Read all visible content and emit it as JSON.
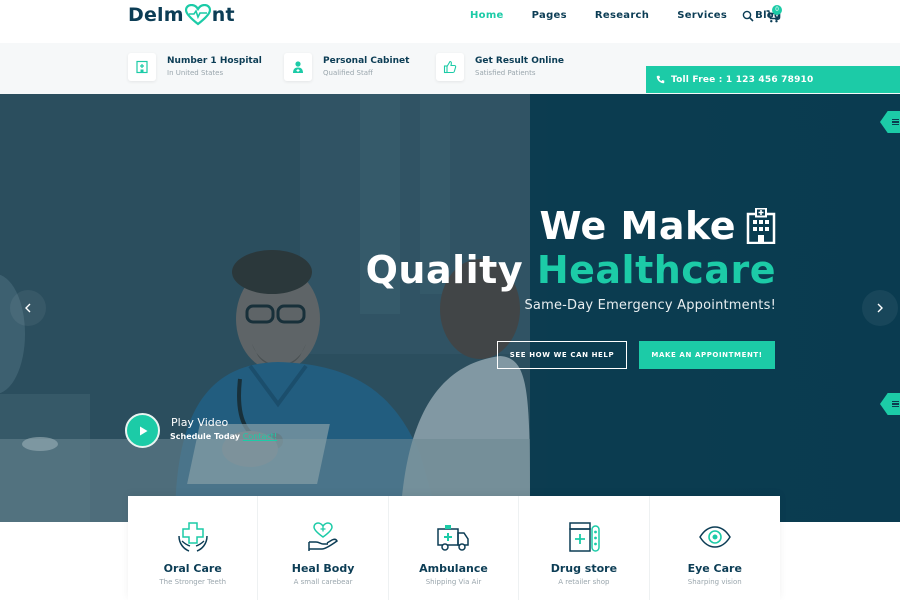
{
  "brand": {
    "name_left": "Delm",
    "name_right": "nt",
    "accent": "#1ccba7",
    "dark": "#0c3d55"
  },
  "nav": {
    "links": [
      "Home",
      "Pages",
      "Research",
      "Services",
      "Blog"
    ],
    "active": "Home",
    "search_icon": "search-icon",
    "cart_icon": "cart-icon",
    "cart_count": "0"
  },
  "info": {
    "items": [
      {
        "title": "Number 1 Hospital",
        "sub": "In United States",
        "icon": "hospital-icon"
      },
      {
        "title": "Personal Cabinet",
        "sub": "Qualified Staff",
        "icon": "doctor-icon"
      },
      {
        "title": "Get Result Online",
        "sub": "Satisfied Patients",
        "icon": "thumbs-up-icon"
      }
    ],
    "tollfree": "Toll Free : 1 123 456 78910"
  },
  "hero": {
    "line1": "We Make",
    "line2_white": "Quality",
    "line2_green": "Healthcare",
    "subtitle": "Same-Day Emergency Appointments!",
    "btn_outline": "SEE HOW WE CAN HELP",
    "btn_solid": "MAKE AN APPOINTMENT!",
    "play_title": "Play Video",
    "play_sub": "Schedule Today",
    "play_link": "Contact!"
  },
  "services": [
    {
      "title": "Oral Care",
      "sub": "The Stronger Teeth",
      "icon": "hands-cross-icon"
    },
    {
      "title": "Heal Body",
      "sub": "A small carebear",
      "icon": "hand-heart-icon"
    },
    {
      "title": "Ambulance",
      "sub": "Shipping Via Air",
      "icon": "ambulance-icon"
    },
    {
      "title": "Drug store",
      "sub": "A retailer shop",
      "icon": "drugstore-icon"
    },
    {
      "title": "Eye Care",
      "sub": "Sharping vision",
      "icon": "eye-icon"
    }
  ]
}
